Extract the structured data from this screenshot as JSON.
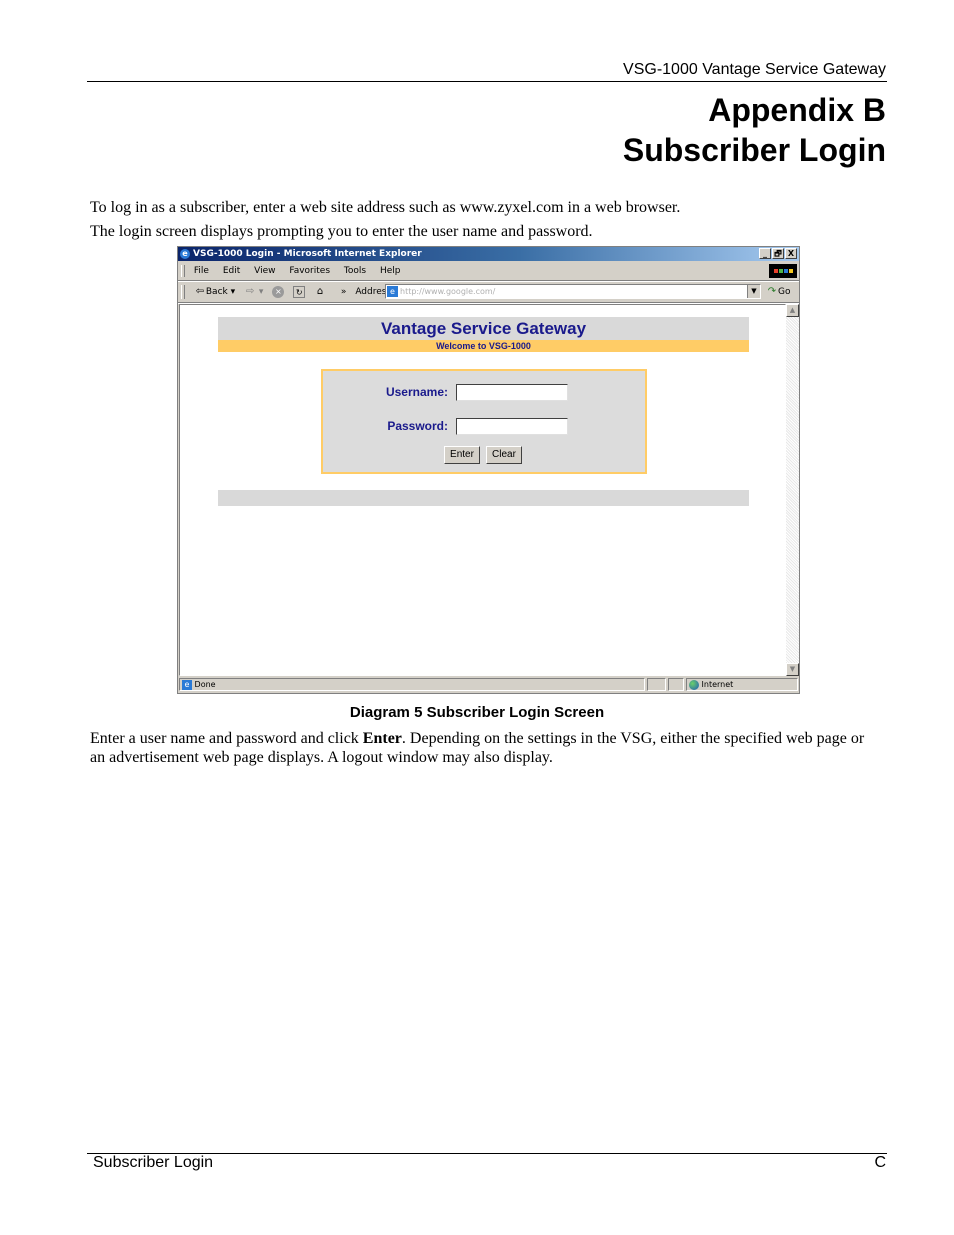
{
  "page_header": {
    "title": "VSG-1000 Vantage Service Gateway"
  },
  "heading": {
    "line1": "Appendix B",
    "line2": "Subscriber Login"
  },
  "intro": {
    "para1": "To log in as a subscriber, enter a web site address such as www.zyxel.com in a web browser.",
    "para2": "The login screen displays prompting you to enter the user name and password."
  },
  "browser": {
    "window_title": "VSG-1000 Login - Microsoft Internet Explorer",
    "window_buttons": [
      "_",
      "🗗",
      "X"
    ],
    "menu": [
      "File",
      "Edit",
      "View",
      "Favorites",
      "Tools",
      "Help"
    ],
    "toolbar": {
      "back_label": "Back",
      "chevron": "»",
      "address_label": "Address",
      "address_value": "http://www.google.com/",
      "go_label": "Go"
    },
    "status": {
      "left": "Done",
      "zone": "Internet"
    },
    "page": {
      "heading": "Vantage Service Gateway",
      "subheading": "Welcome to VSG-1000",
      "username_label": "Username:",
      "username_value": "",
      "password_label": "Password:",
      "password_value": "",
      "enter_button": "Enter",
      "clear_button": "Clear"
    }
  },
  "caption": "Diagram 5 Subscriber Login Screen",
  "body": {
    "para_before_bold": "Enter a user name and password and click ",
    "bold": "Enter",
    "para_after_bold": ". Depending on the settings in the VSG, either the specified web page or an advertisement web page displays. A logout window may also display."
  },
  "footer": {
    "left": "Subscriber Login",
    "right": "C"
  }
}
